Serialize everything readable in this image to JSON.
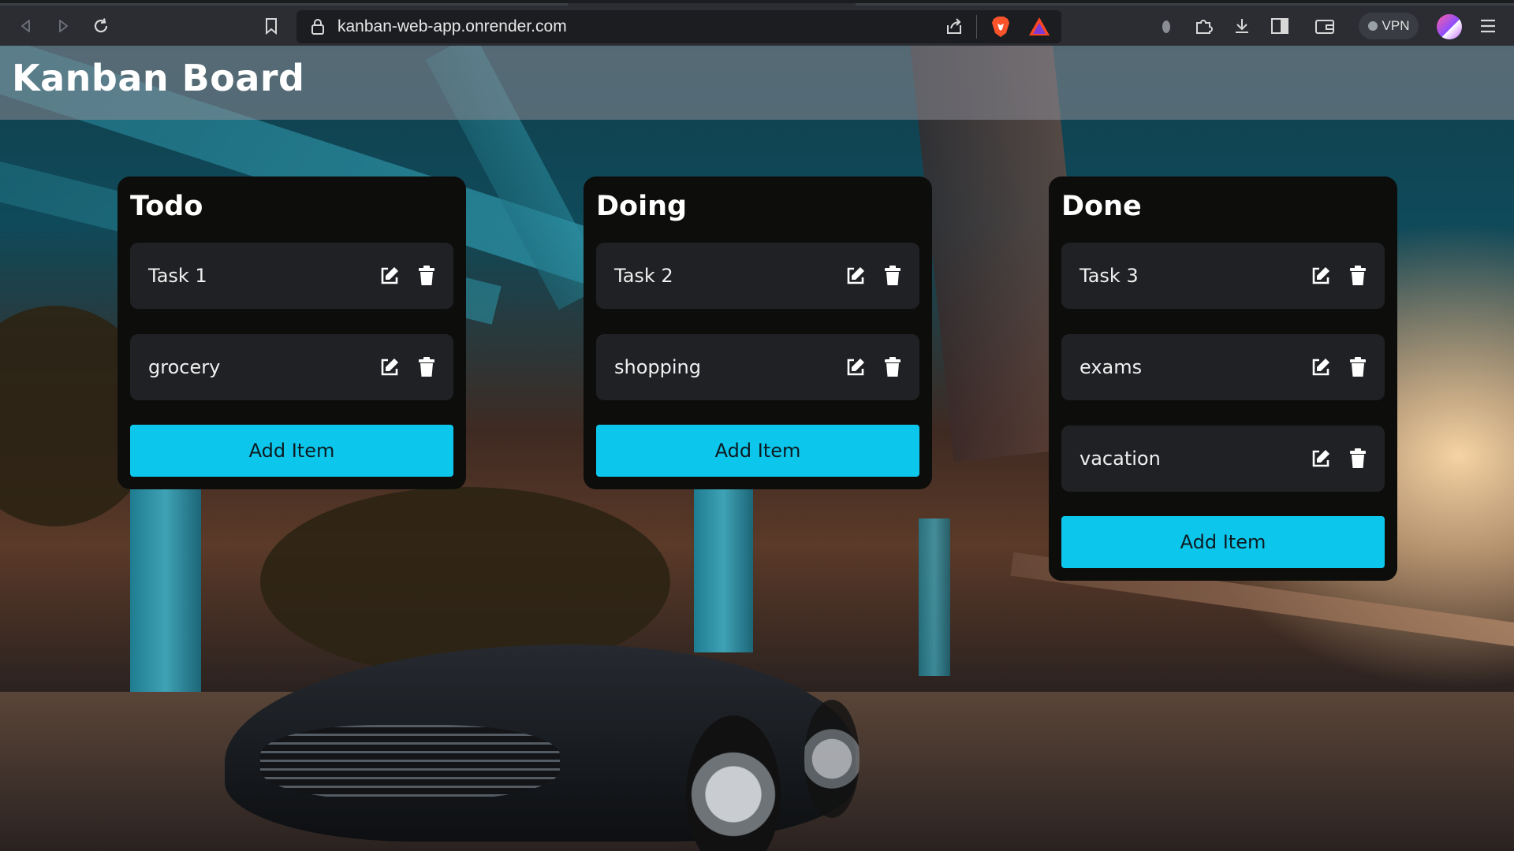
{
  "browser": {
    "url": "kanban-web-app.onrender.com",
    "vpn_label": "VPN",
    "icons": [
      "back-icon",
      "forward-icon",
      "reload-icon",
      "bookmark-icon",
      "lock-icon",
      "share-icon",
      "brave-shield-icon",
      "brave-rewards-icon",
      "extension-puzzle-icon",
      "download-icon",
      "sidebar-icon",
      "wallet-icon",
      "menu-icon"
    ]
  },
  "app": {
    "title": "Kanban Board",
    "columns": [
      {
        "title": "Todo",
        "tasks": [
          "Task 1",
          "grocery"
        ],
        "add_label": "Add Item"
      },
      {
        "title": "Doing",
        "tasks": [
          "Task 2",
          "shopping"
        ],
        "add_label": "Add Item"
      },
      {
        "title": "Done",
        "tasks": [
          "Task 3",
          "exams",
          "vacation"
        ],
        "add_label": "Add Item"
      }
    ]
  },
  "colors": {
    "accent": "#0cc7eb",
    "column_bg": "#0d0d0b",
    "card_bg": "#202124"
  }
}
